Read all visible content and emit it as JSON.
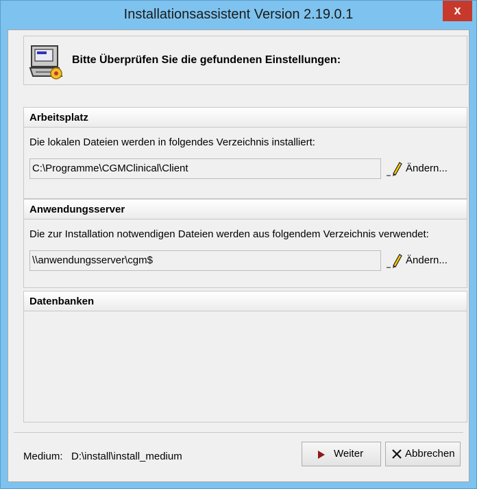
{
  "window": {
    "title": "Installationsassistent  Version 2.19.0.1",
    "close_label": "x"
  },
  "header": {
    "icon": "computer-setup-icon",
    "text": "Bitte Überprüfen Sie die gefundenen Einstellungen:"
  },
  "workstation": {
    "title": "Arbeitsplatz",
    "description": "Die lokalen Dateien werden in folgendes Verzeichnis installiert:",
    "path": "C:\\Programme\\CGMClinical\\Client",
    "change_label": "Ändern..."
  },
  "app_server": {
    "title": "Anwendungsserver",
    "description": "Die zur Installation notwendigen Dateien werden aus folgendem Verzeichnis verwendet:",
    "path": "\\\\anwendungsserver\\cgm$",
    "change_label": "Ändern..."
  },
  "databases": {
    "title": "Datenbanken"
  },
  "footer": {
    "medium_label": "Medium:",
    "medium_value": "D:\\install\\install_medium",
    "next_label": "Weiter",
    "cancel_label": "Abbrechen"
  },
  "colors": {
    "titlebar": "#7ec3ef",
    "close": "#c7392b",
    "client": "#f0f0f0",
    "next_arrow": "#8b1a1a"
  }
}
